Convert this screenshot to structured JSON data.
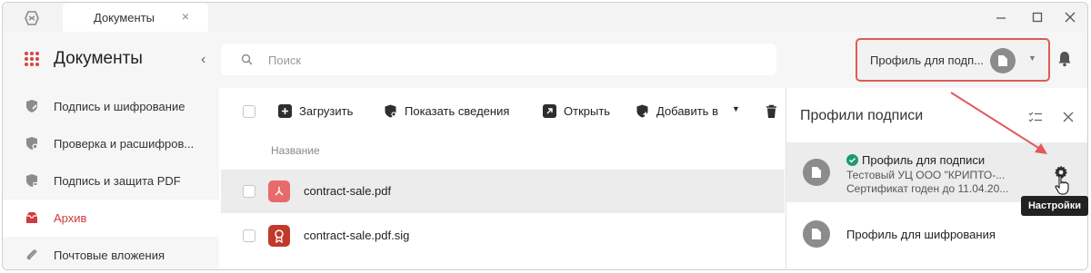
{
  "titlebar": {
    "tab_label": "Документы",
    "tab_close": "×"
  },
  "header": {
    "app_title": "Документы",
    "collapse_icon": "‹",
    "search_placeholder": "Поиск",
    "profile_select_label": "Профиль для подп...",
    "profile_caret": "▼"
  },
  "sidebar": {
    "items": [
      {
        "label": "Подпись и шифрование",
        "icon": "shield-pen-icon"
      },
      {
        "label": "Проверка и расшифров...",
        "icon": "shield-check-icon"
      },
      {
        "label": "Подпись и защита PDF",
        "icon": "shield-lock-icon"
      },
      {
        "label": "Архив",
        "icon": "archive-icon"
      },
      {
        "label": "Почтовые вложения",
        "icon": "paperclip-icon"
      }
    ]
  },
  "toolbar": {
    "upload_label": "Загрузить",
    "show_info_label": "Показать сведения",
    "open_label": "Открыть",
    "add_to_label": "Добавить в"
  },
  "files": {
    "column_name": "Название",
    "rows": [
      {
        "name": "contract-sale.pdf",
        "color": "#e86a6a"
      },
      {
        "name": "contract-sale.pdf.sig",
        "color": "#c0392b"
      }
    ]
  },
  "panel": {
    "title": "Профили подписи",
    "profiles": [
      {
        "name": "Профиль для подписи",
        "issuer": "Тестовый УЦ ООО \"КРИПТО-...",
        "validity": "Сертификат годен до 11.04.20..."
      },
      {
        "name": "Профиль для шифрования"
      }
    ],
    "tooltip": "Настройки"
  },
  "colors": {
    "accent": "#d13b3b",
    "highlight_border": "#e05a5a",
    "ok_green": "#1a9a74"
  }
}
